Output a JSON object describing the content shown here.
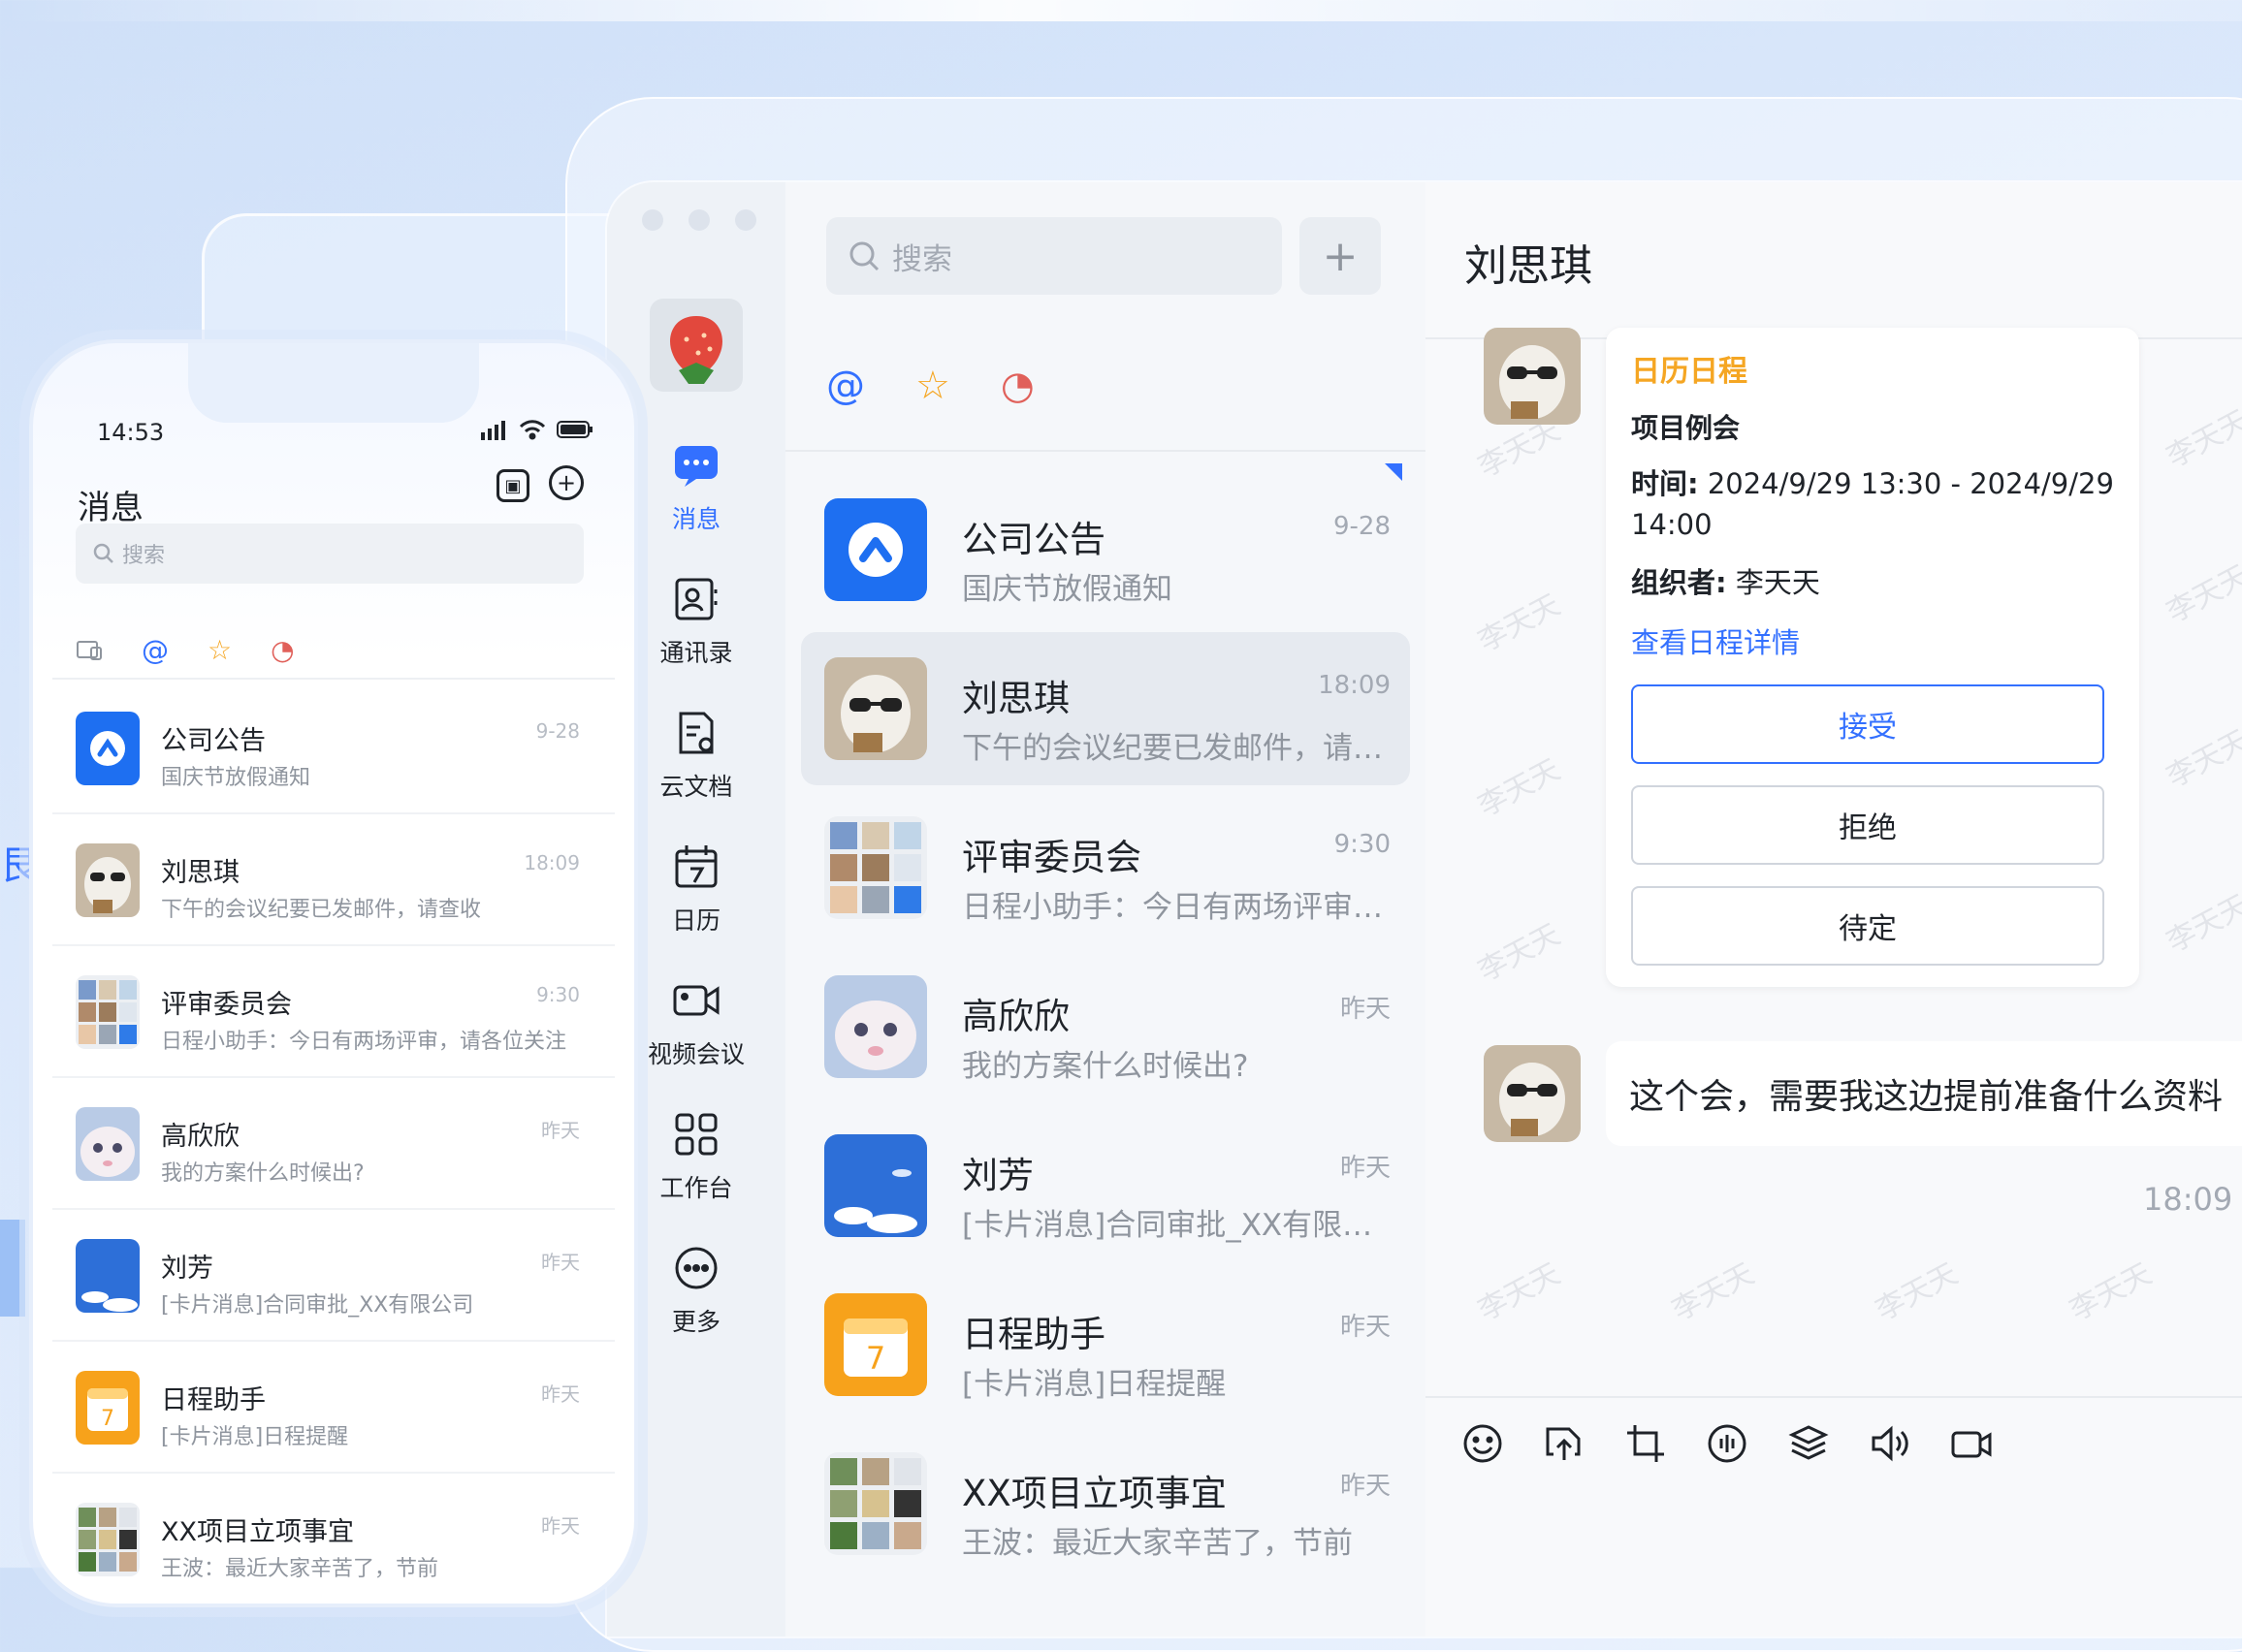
{
  "desktop": {
    "search_placeholder": "搜索",
    "plus": "+",
    "rail": [
      {
        "label": "消息",
        "active": true
      },
      {
        "label": "通讯录"
      },
      {
        "label": "云文档"
      },
      {
        "label": "日历"
      },
      {
        "label": "视频会议"
      },
      {
        "label": "工作台"
      },
      {
        "label": "更多"
      }
    ],
    "filters": [
      "@",
      "☆",
      "◔"
    ],
    "conversations": [
      {
        "name": "公司公告",
        "preview": "国庆节放假通知",
        "time": "9-28",
        "avatar": "announcement"
      },
      {
        "name": "刘思琪",
        "preview": "下午的会议纪要已发邮件，请查收",
        "time": "18:09",
        "avatar": "sheep"
      },
      {
        "name": "评审委员会",
        "preview": "日程小助手：今日有两场评审，请各位关注",
        "time": "9:30",
        "avatar": "grid"
      },
      {
        "name": "高欣欣",
        "preview": "我的方案什么时候出?",
        "time": "昨天",
        "avatar": "cat"
      },
      {
        "name": "刘芳",
        "preview": "[卡片消息]合同审批_XX有限公司",
        "time": "昨天",
        "avatar": "sky"
      },
      {
        "name": "日程助手",
        "preview": "[卡片消息]日程提醒",
        "time": "昨天",
        "avatar": "calendar"
      },
      {
        "name": "XX项目立项事宜",
        "preview": "王波：最近大家辛苦了，节前",
        "time": "昨天",
        "avatar": "grid"
      }
    ],
    "chat": {
      "title": "刘思琪",
      "watermark": "李天天",
      "card": {
        "title": "日历日程",
        "subject": "项目例会",
        "time_label": "时间:",
        "time_value": "2024/9/29 13:30 - 2024/9/29 14:00",
        "organizer_label": "组织者:",
        "organizer_value": "李天天",
        "link": "查看日程详情",
        "accept": "接受",
        "decline": "拒绝",
        "pending": "待定"
      },
      "message": "这个会，需要我这边提前准备什么资料",
      "message_time": "18:09"
    }
  },
  "phone": {
    "time": "14:53",
    "title": "消息",
    "search_placeholder": "搜索",
    "conversations": [
      {
        "name": "公司公告",
        "preview": "国庆节放假通知",
        "time": "9-28",
        "avatar": "announcement"
      },
      {
        "name": "刘思琪",
        "preview": "下午的会议纪要已发邮件，请查收",
        "time": "18:09",
        "avatar": "sheep"
      },
      {
        "name": "评审委员会",
        "preview": "日程小助手：今日有两场评审，请各位关注",
        "time": "9:30",
        "avatar": "grid"
      },
      {
        "name": "高欣欣",
        "preview": "我的方案什么时候出?",
        "time": "昨天",
        "avatar": "cat"
      },
      {
        "name": "刘芳",
        "preview": "[卡片消息]合同审批_XX有限公司",
        "time": "昨天",
        "avatar": "sky"
      },
      {
        "name": "日程助手",
        "preview": "[卡片消息]日程提醒",
        "time": "昨天",
        "avatar": "calendar"
      },
      {
        "name": "XX项目立项事宜",
        "preview": "王波：最近大家辛苦了，节前",
        "time": "昨天",
        "avatar": "grid"
      }
    ]
  },
  "left_partial_text": "艮",
  "colors": {
    "accent": "#3370ff",
    "card_title": "#f5a623"
  }
}
